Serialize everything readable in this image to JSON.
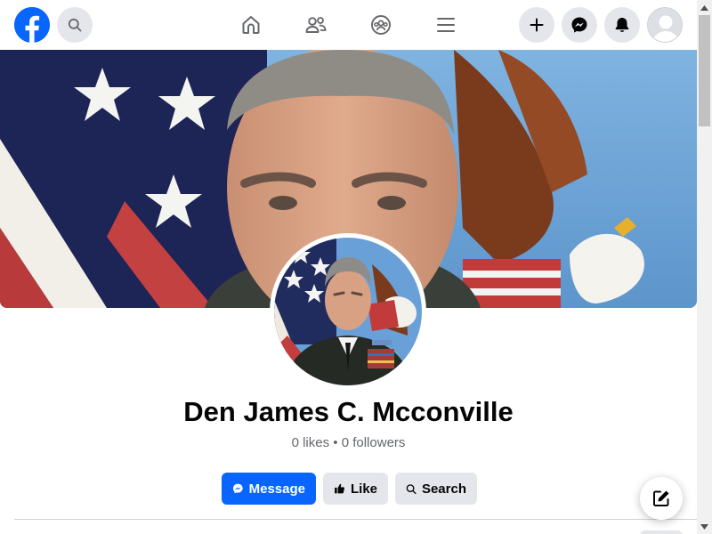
{
  "profile": {
    "name": "Den James C. Mcconville",
    "likes": "0 likes",
    "separator": " • ",
    "followers": "0 followers"
  },
  "actions": {
    "message_label": "Message",
    "like_label": "Like",
    "search_label": "Search"
  },
  "colors": {
    "brand": "#0866ff",
    "secondary_button": "#e4e6eb",
    "text_primary": "#050505",
    "text_secondary": "#65676b"
  },
  "icons": {
    "logo": "facebook-logo",
    "search": "search-icon",
    "home": "home-icon",
    "friends": "friends-icon",
    "groups": "groups-icon",
    "menu": "menu-icon",
    "create": "plus-icon",
    "messenger": "messenger-icon",
    "notifications": "bell-icon",
    "account": "avatar",
    "compose": "compose-icon"
  }
}
